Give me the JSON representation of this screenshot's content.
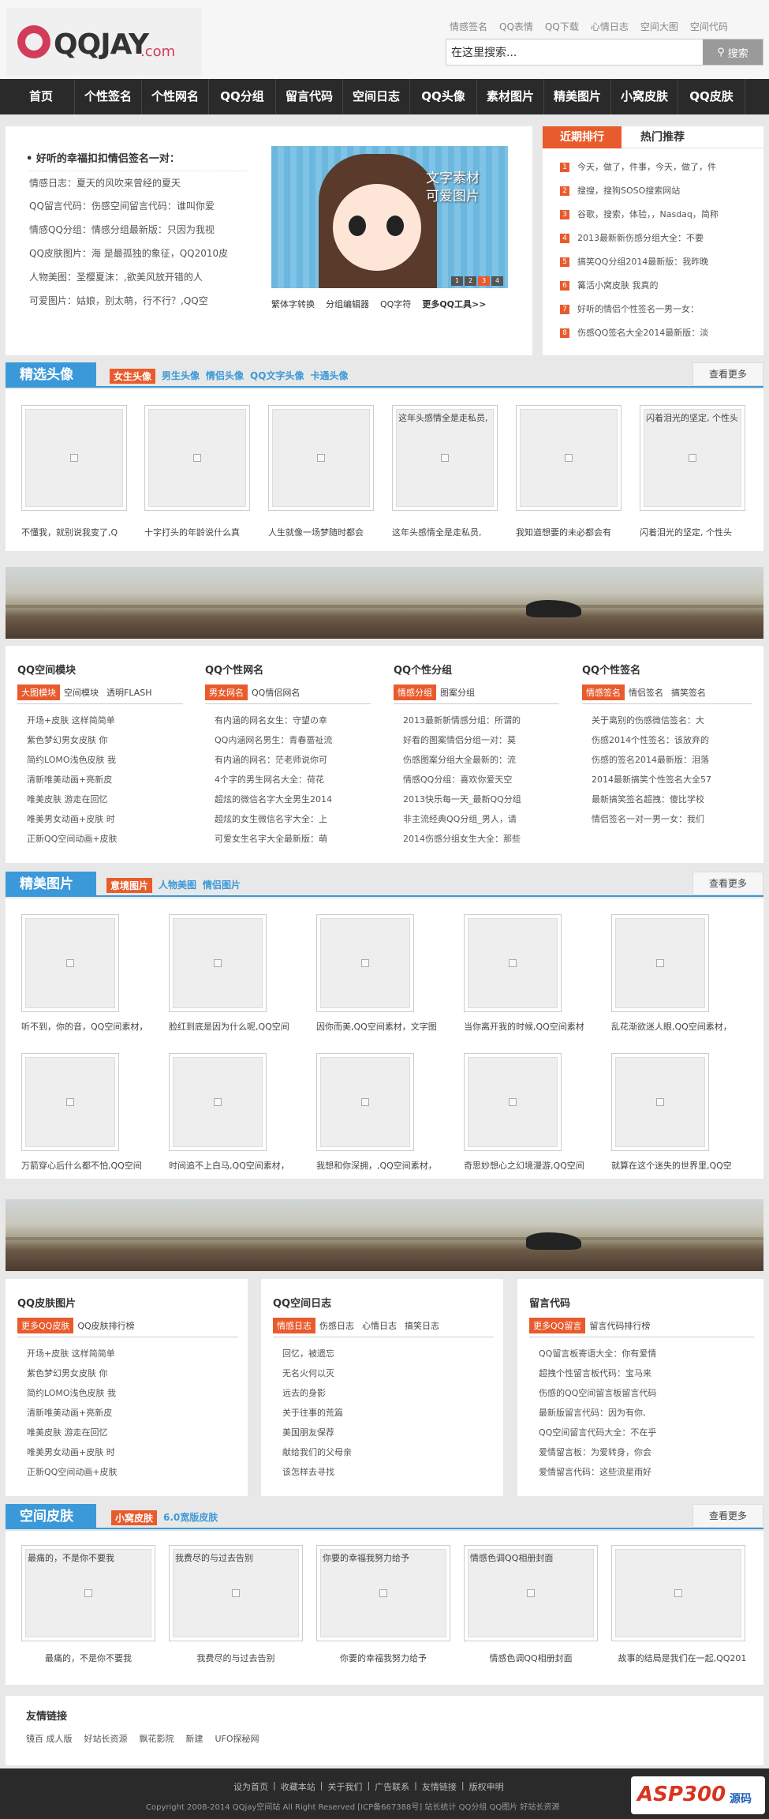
{
  "site": {
    "logo_text": "QQJAY",
    "logo_suffix": ".com"
  },
  "toplinks": [
    "情感签名",
    "QQ表情",
    "QQ下载",
    "心情日志",
    "空间大图",
    "空间代码"
  ],
  "search": {
    "value": "在这里搜索...",
    "button": "搜索"
  },
  "nav": [
    "首页",
    "个性签名",
    "个性网名",
    "QQ分组",
    "留言代码",
    "空间日志",
    "QQ头像",
    "素材图片",
    "精美图片",
    "小窝皮肤",
    "QQ皮肤"
  ],
  "featured": {
    "title": "• 好听的幸福扣扣情侣签名一对：",
    "lines": [
      "情感日志：夏天的风吹来曾经的夏天",
      "QQ留言代码：伤感空间留言代码：谁叫你爱",
      "情感QQ分组：情感分组最新版：只因为我视",
      "QQ皮肤图片：海 是最孤独的象征，QQ2010皮",
      "人物美图：圣樱夏沫：,欲美风放开错的人",
      "可爱图片：姑娘，别太萌，行不行？,QQ空"
    ],
    "banner_text": [
      "文字素材",
      "可爱图片"
    ],
    "tools": [
      "繁体字转换",
      "分组编辑器",
      "QQ字符",
      "更多QQ工具>>"
    ],
    "pager": [
      "1",
      "2",
      "3",
      "4"
    ]
  },
  "rank": {
    "tabs": [
      "近期排行",
      "热门推荐"
    ],
    "items": [
      "今天，做了，件事，今天，做了，件",
      "搜搜，搜狗SOSO搜索网站",
      "谷歌，搜索，体验，，Nasdaq，简称",
      "2013最新新伤感分组大全：不要",
      "搞笑QQ分组2014最新版：我昨晚",
      "篝活小窝皮肤 我真的",
      "好听的情侣个性签名一男一女：",
      "伤感QQ签名大全2014最新版：淡"
    ],
    "nums": [
      "1",
      "2",
      "3",
      "4",
      "5",
      "6",
      "7",
      "8"
    ]
  },
  "avatars": {
    "label": "精选头像",
    "subs": [
      "女生头像",
      "男生头像",
      "情侣头像",
      "QQ文字头像",
      "卡通头像"
    ],
    "more": "查看更多",
    "thumb_caps": [
      "",
      "",
      "",
      "这年头感情全是走私员,",
      "",
      "闪着泪光的坚定, 个性头"
    ],
    "caps": [
      "不懂我，就别说我变了,Q",
      "十字打头的年龄说什么真",
      "人生就像一场梦随时都会",
      "这年头感情全是走私员,",
      "我知道想要的未必都会有",
      "闪着泪光的坚定, 个性头"
    ]
  },
  "cols1": [
    {
      "title": "QQ空间模块",
      "tabs": [
        "大图模块",
        "空间模块",
        "透明FLASH"
      ],
      "items": [
        "开场+皮肤 这样简简单",
        "紫色梦幻男女皮肤 你",
        "简约LOMO浅色皮肤 我",
        "清新唯美动画+亮新皮",
        "唯美皮肤 游走在回忆",
        "唯美男女动画+皮肤 时",
        "正新QQ空间动画+皮肤"
      ]
    },
    {
      "title": "QQ个性网名",
      "tabs": [
        "男女网名",
        "QQ情侣网名"
      ],
      "items": [
        "有内涵的网名女生：守望の幸",
        "QQ内涵网名男生：青春蔷祉流",
        "有内涵的网名：茫老师说你可",
        "4个字的男生网名大全：荷花",
        "超炫的微信名字大全男生2014",
        "超炫的女生微信名字大全：上",
        "可爱女生名字大全最新版：萌"
      ]
    },
    {
      "title": "QQ个性分组",
      "tabs": [
        "情感分组",
        "图案分组"
      ],
      "items": [
        "2013最新新情感分组：所谓的",
        "好看的图案情侣分组一对：莫",
        "伤感图案分组大全最新的：流",
        "情感QQ分组：喜欢你爱天空",
        "2013快乐每一天_最新QQ分组",
        "非主流经典QQ分组_男人，请",
        "2014伤感分组女生大全：那些"
      ]
    },
    {
      "title": "QQ个性签名",
      "tabs": [
        "情感签名",
        "情侣签名",
        "搞笑签名"
      ],
      "items": [
        "关于离别的伤感微信签名：大",
        "伤感2014个性签名：该放弃的",
        "伤感的签名2014最新版：泪落",
        "2014最新搞笑个性签名大全57",
        "最新搞笑签名超拽：傻比学校",
        "情侣签名一对一男一女：我们"
      ]
    }
  ],
  "photos": {
    "label": "精美图片",
    "subs": [
      "意境图片",
      "人物美图",
      "情侣图片"
    ],
    "more": "查看更多",
    "row1": [
      "听不到，你的音，QQ空间素材，",
      "脸红到底是因为什么呢,QQ空间",
      "因你而美,QQ空间素材，文字图",
      "当你离开我的时候,QQ空间素材",
      "乱花渐欲迷人眼,QQ空间素材，"
    ],
    "row2": [
      "万箭穿心后什么都不怕,QQ空间",
      "时间追不上白马,QQ空间素材，",
      "我想和你深拥，,QQ空间素材，",
      "奇思妙想心之幻境漫游,QQ空间",
      "就算在这个迷失的世界里,QQ空"
    ]
  },
  "cols2": [
    {
      "title": "QQ皮肤图片",
      "tabs": [
        "更多QQ皮肤",
        "QQ皮肤排行榜"
      ],
      "items": [
        "开场+皮肤 这样简简单",
        "紫色梦幻男女皮肤 你",
        "简约LOMO浅色皮肤 我",
        "清新唯美动画+亮新皮",
        "唯美皮肤 游走在回忆",
        "唯美男女动画+皮肤 时",
        "正新QQ空间动画+皮肤"
      ]
    },
    {
      "title": "QQ空间日志",
      "tabs": [
        "情感日志",
        "伤感日志",
        "心情日志",
        "搞笑日志"
      ],
      "items": [
        "回忆，被遗忘",
        "无名火何以灭",
        "远去的身影",
        "关于往事的荒篇",
        "美国朋友保荐",
        "献给我们的父母亲",
        "该怎样去寻找"
      ]
    },
    {
      "title": "留言代码",
      "tabs": [
        "更多QQ留言",
        "留言代码排行榜"
      ],
      "items": [
        "QQ留言板寄语大全：你有爱情",
        "超拽个性留言板代码：宝马来",
        "伤感的QQ空间留言板留言代码",
        "最新版留言代码：因为有你,",
        "QQ空间留言代码大全：不在乎",
        "爱情留言板：为爱转身，你会",
        "爱情留言代码：这些流星雨好"
      ]
    }
  ],
  "skins": {
    "label": "空间皮肤",
    "subs": [
      "小窝皮肤",
      "6.0宽版皮肤"
    ],
    "more": "查看更多",
    "thumb_caps": [
      "最痛的，不是你不要我",
      "我费尽的与过去告别",
      "你要的幸福我努力给予",
      "情感色调QQ相册封面",
      ""
    ],
    "caps": [
      "最痛的，不是你不要我",
      "我费尽的与过去告别",
      "你要的幸福我努力给予",
      "情感色调QQ相册封面",
      "故事的结局是我们在一起,QQ201"
    ]
  },
  "friends": {
    "title": "友情链接",
    "items": [
      "镜百 成人版",
      "好站长资源",
      "飘花影院",
      "新建",
      "UFO探秘网"
    ]
  },
  "footer": {
    "links": [
      "设为首页",
      "收藏本站",
      "关于我们",
      "广告联系",
      "友情链接",
      "版权申明"
    ],
    "copyright": "Copyright 2008-2014 QQjay空间站 All Right Reserved [ICP备667388号] 站长统计 QQ分组 QQ图片 好站长资源",
    "badge": "ASP300",
    "badge_sub": "源码"
  },
  "colors": {
    "accent": "#3b99d9",
    "orange": "#e85b2c",
    "nav": "#2a2a2a"
  }
}
